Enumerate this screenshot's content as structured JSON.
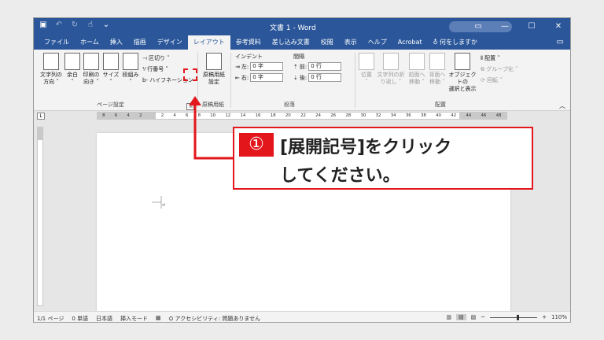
{
  "titlebar": {
    "title": "文書 1 - Word",
    "qat_icons": [
      "save-icon",
      "undo-icon",
      "redo-icon",
      "touch-icon",
      "customize-icon"
    ],
    "buttons": [
      "ribbon-display-icon",
      "minimize-icon",
      "maximize-icon",
      "close-icon"
    ]
  },
  "tabs": [
    "ファイル",
    "ホーム",
    "挿入",
    "描画",
    "デザイン",
    "レイアウト",
    "参考資料",
    "差し込み文書",
    "校閲",
    "表示",
    "ヘルプ",
    "Acrobat",
    "何をしますか"
  ],
  "active_tab": "レイアウト",
  "ribbon": {
    "page_setup": {
      "label": "ページ設定",
      "text_direction": "文字列の\n方向 ˅",
      "margins": "余白\n˅",
      "orientation": "印刷の\n向き ˅",
      "size": "サイズ\n˅",
      "columns": "段組み\n˅",
      "breaks": "区切り ˅",
      "line_numbers": "行番号 ˅",
      "hyphenation": "ハイフネーション ˅"
    },
    "genko": {
      "label": "原稿用紙",
      "button": "原稿用紙\n設定"
    },
    "paragraph": {
      "label": "段落",
      "indent_label": "インデント",
      "spacing_label": "間隔",
      "left_label": "左:",
      "left_value": "0 字",
      "right_label": "右:",
      "right_value": "0 字",
      "before_label": "前:",
      "before_value": "0 行",
      "after_label": "後:",
      "after_value": "0 行"
    },
    "arrange": {
      "label": "配置",
      "position": "位置\n˅",
      "wrap": "文字列の折\nり返し ˅",
      "forward": "前面へ\n移動 ˅",
      "backward": "背面へ\n移動 ˅",
      "selection": "オブジェクトの\n選択と表示",
      "align": "配置 ˅",
      "group": "グループ化 ˅",
      "rotate": "回転 ˅"
    }
  },
  "ruler": {
    "numbers": [
      "8",
      "6",
      "4",
      "2",
      "",
      "2",
      "4",
      "6",
      "8",
      "10",
      "12",
      "14",
      "16",
      "18",
      "20",
      "22",
      "24",
      "26",
      "28",
      "30",
      "32",
      "34",
      "36",
      "38",
      "40",
      "42",
      "44",
      "46",
      "48"
    ]
  },
  "statusbar": {
    "page": "1/1 ページ",
    "words": "0 単語",
    "language": "日本語",
    "mode": "挿入モード",
    "accessibility": "アクセシビリティ: 問題ありません",
    "zoom": "110%"
  },
  "callout": {
    "badge": "①",
    "line1": "[展開記号]をクリック",
    "line2": "してください。"
  },
  "colors": {
    "word_blue": "#2b579a",
    "highlight_red": "#e3161c"
  }
}
